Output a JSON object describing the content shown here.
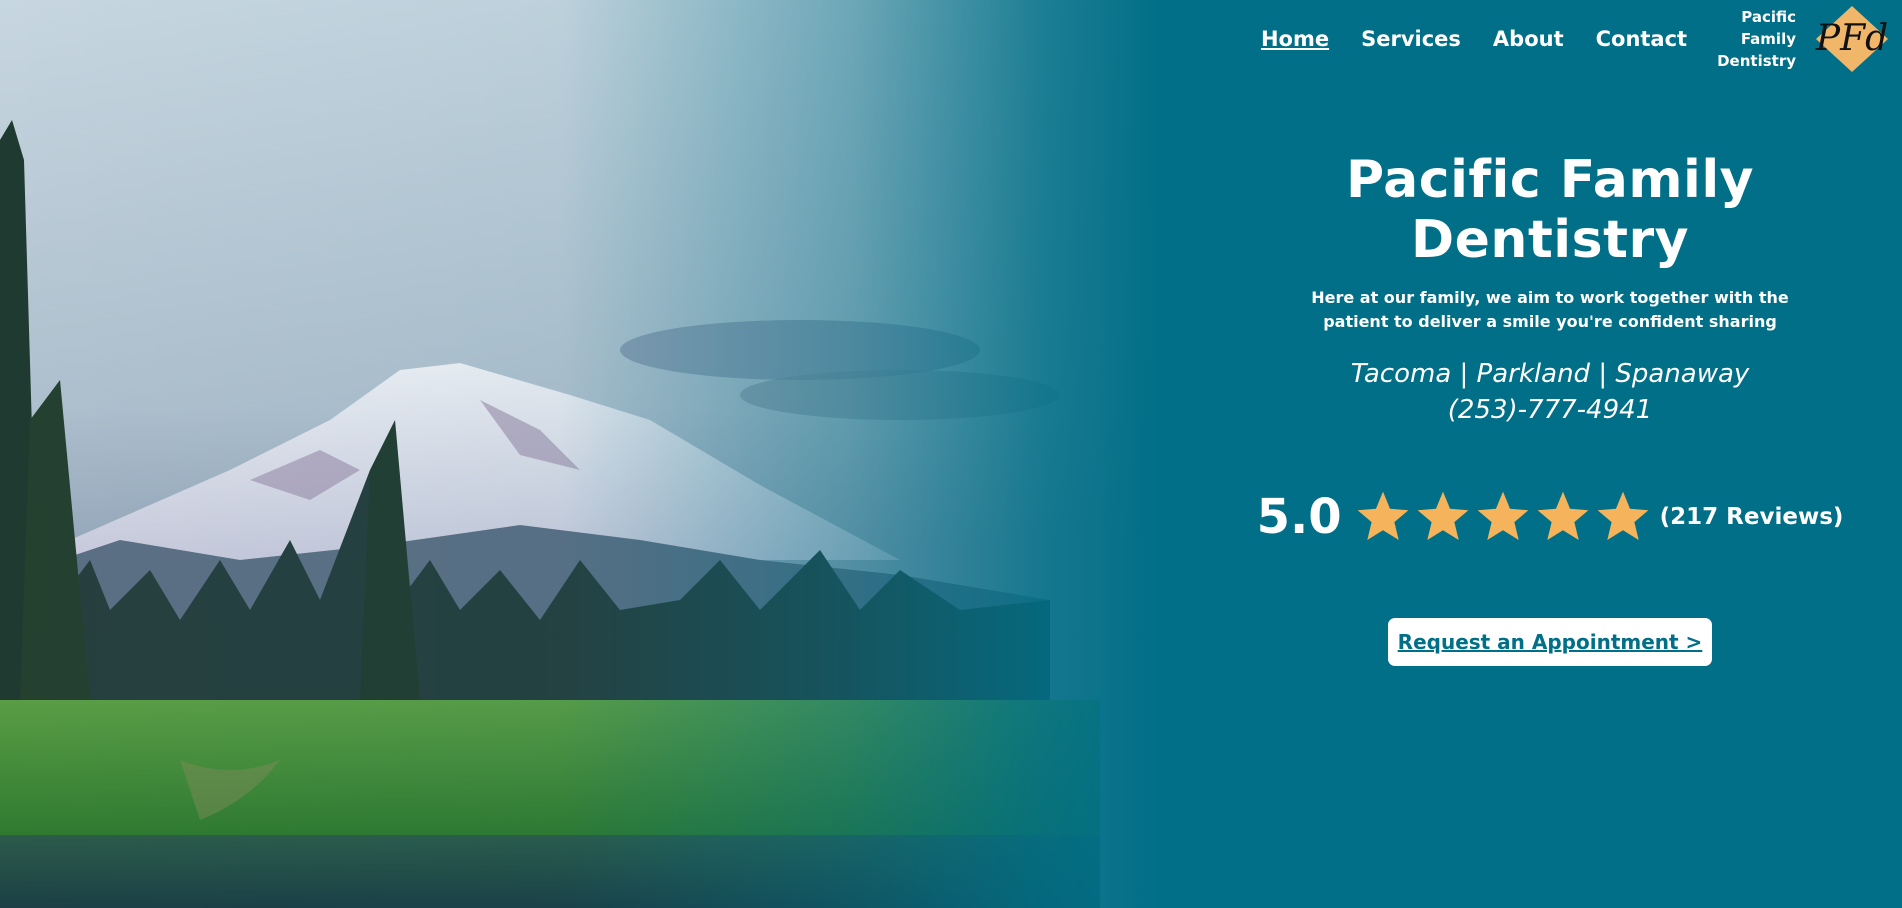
{
  "nav": {
    "links": [
      {
        "label": "Home",
        "active": true
      },
      {
        "label": "Services"
      },
      {
        "label": "About"
      },
      {
        "label": "Contact"
      }
    ],
    "brand_lines": [
      "Pacific",
      "Family",
      "Dentistry"
    ],
    "logo_text": "PFd"
  },
  "hero": {
    "title": "Pacific Family Dentistry",
    "tagline": "Here at our family, we aim to work together with the patient to deliver a smile you're confident sharing",
    "locations": "Tacoma | Parkland | Spanaway",
    "phone": "(253)-777-4941",
    "rating": {
      "score": "5.0",
      "stars": 5,
      "reviews": "(217 Reviews)"
    },
    "cta_label": "Request an Appointment >"
  },
  "colors": {
    "brand": "#006f87",
    "star": "#f5b45c",
    "logo_diamond": "#f0b76a"
  },
  "icons": {
    "rating": "star-icon",
    "logo": "pfd-logo"
  }
}
